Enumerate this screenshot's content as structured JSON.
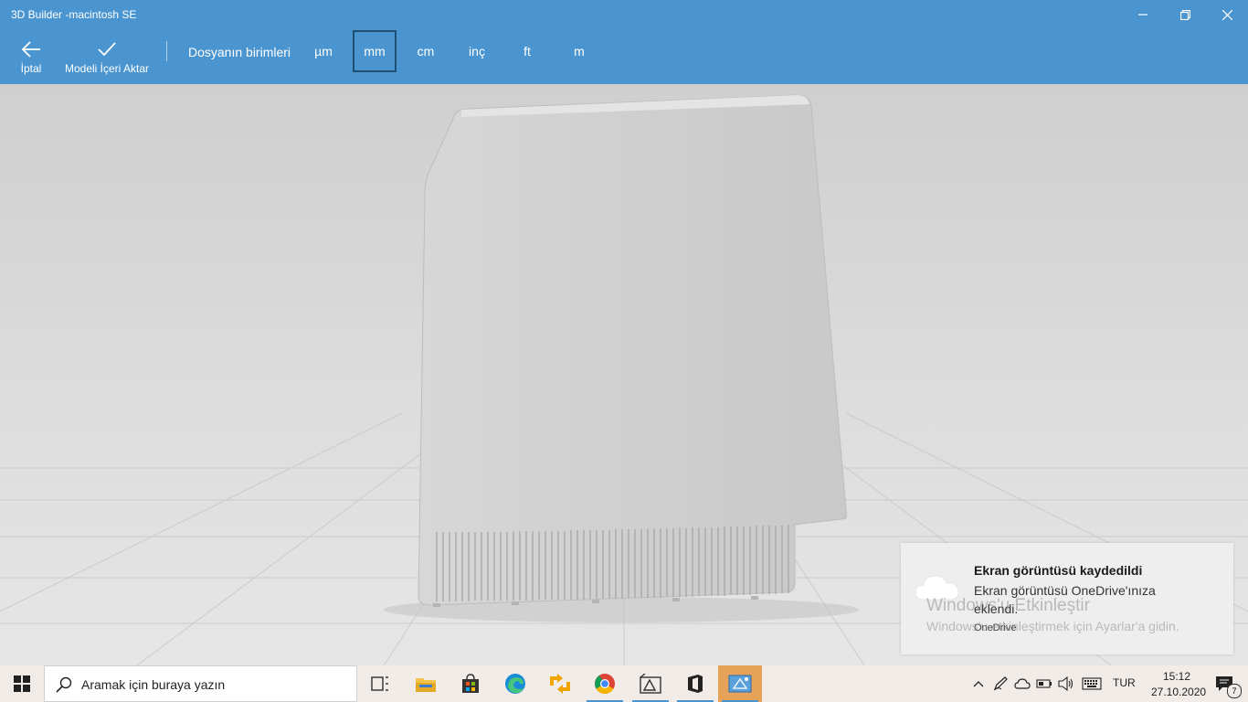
{
  "window": {
    "title": "3D Builder -macintosh SE"
  },
  "commands": {
    "cancel_label": "İptal",
    "import_label": "Modeli İçeri Aktar"
  },
  "units": {
    "label": "Dosyanın birimleri",
    "options": [
      "µm",
      "mm",
      "cm",
      "inç",
      "ft",
      "m"
    ],
    "selected": "mm"
  },
  "toast": {
    "title": "Ekran görüntüsü kaydedildi",
    "body": "Ekran görüntüsü OneDrive'ınıza eklendi.",
    "app": "OneDrive"
  },
  "watermark": {
    "line1": "Windows'u Etkinleştir",
    "line2": "Windows'u etkinleştirmek için Ayarlar'a gidin."
  },
  "taskbar": {
    "search_placeholder": "Aramak için buraya yazın",
    "language": "TUR",
    "time": "15:12",
    "date": "27.10.2020",
    "notification_count": "7"
  },
  "colors": {
    "accent": "#4a95d0",
    "selected_border": "#1f4f73",
    "active_app": "#e7a25a"
  }
}
